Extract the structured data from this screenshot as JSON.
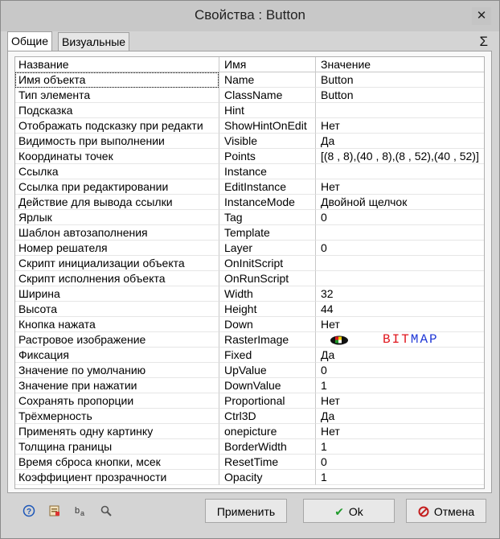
{
  "window": {
    "title": "Свойства :   Button",
    "close_label": "✕"
  },
  "tabs": [
    {
      "label": "Общие"
    },
    {
      "label": "Визуальные слои"
    }
  ],
  "sigma": "Σ",
  "table": {
    "headers": [
      "Название",
      "Имя",
      "Значение"
    ],
    "rows": [
      {
        "name": "Имя объекта",
        "id": "Name",
        "value": "Button"
      },
      {
        "name": "Тип элемента",
        "id": "ClassName",
        "value": "Button"
      },
      {
        "name": "Подсказка",
        "id": "Hint",
        "value": ""
      },
      {
        "name": "Отображать подсказку при редакти",
        "id": "ShowHintOnEdit",
        "value": "Нет"
      },
      {
        "name": "Видимость при выполнении",
        "id": "Visible",
        "value": "Да"
      },
      {
        "name": "Координаты точек",
        "id": "Points",
        "value": "[(8 , 8),(40 , 8),(8 , 52),(40 , 52)]"
      },
      {
        "name": "Ссылка",
        "id": "Instance",
        "value": ""
      },
      {
        "name": "Ссылка при редактировании",
        "id": "EditInstance",
        "value": "Нет"
      },
      {
        "name": "Действие для вывода ссылки",
        "id": "InstanceMode",
        "value": "Двойной щелчок"
      },
      {
        "name": "Ярлык",
        "id": "Tag",
        "value": "0"
      },
      {
        "name": "Шаблон автозаполнения",
        "id": "Template",
        "value": ""
      },
      {
        "name": "Номер решателя",
        "id": "Layer",
        "value": "0"
      },
      {
        "name": "Скрипт инициализации объекта",
        "id": "OnInitScript",
        "value": ""
      },
      {
        "name": "Скрипт исполнения объекта",
        "id": "OnRunScript",
        "value": ""
      },
      {
        "name": "Ширина",
        "id": "Width",
        "value": "32"
      },
      {
        "name": "Высота",
        "id": "Height",
        "value": "44"
      },
      {
        "name": "Кнопка нажата",
        "id": "Down",
        "value": "Нет"
      },
      {
        "name": "Растровое изображение",
        "id": "RasterImage",
        "value": ""
      },
      {
        "name": "Фиксация",
        "id": "Fixed",
        "value": "Да"
      },
      {
        "name": "Значение по умолчанию",
        "id": "UpValue",
        "value": "0"
      },
      {
        "name": "Значение при нажатии",
        "id": "DownValue",
        "value": "1"
      },
      {
        "name": "Сохранять пропорции",
        "id": "Proportional",
        "value": "Нет"
      },
      {
        "name": "Трёхмерность",
        "id": "Ctrl3D",
        "value": "Да"
      },
      {
        "name": "Применять одну картинку",
        "id": "onepicture",
        "value": "Нет"
      },
      {
        "name": "Толщина границы",
        "id": "BorderWidth",
        "value": "1"
      },
      {
        "name": "Время сброса кнопки, мсек",
        "id": "ResetTime",
        "value": "0"
      },
      {
        "name": "Коэффициент прозрачности",
        "id": "Opacity",
        "value": "1"
      }
    ]
  },
  "bitmap": {
    "letters": [
      {
        "ch": "B",
        "color": "#e0161d"
      },
      {
        "ch": "I",
        "color": "#e0161d"
      },
      {
        "ch": "T",
        "color": "#e0161d"
      },
      {
        "ch": "M",
        "color": "#1f37d6"
      },
      {
        "ch": "A",
        "color": "#1f37d6"
      },
      {
        "ch": "P",
        "color": "#1f37d6"
      }
    ],
    "icon": "bitmap-thumbnail-icon"
  },
  "footer": {
    "icons": [
      "help-icon",
      "properties-icon",
      "text-format-icon",
      "search-icon"
    ],
    "apply_label": "Применить",
    "ok_label": "Ok",
    "cancel_label": "Отмена"
  },
  "colors": {
    "ok_check": "#1f9a2a",
    "cancel_icon": "#c41e1e"
  }
}
